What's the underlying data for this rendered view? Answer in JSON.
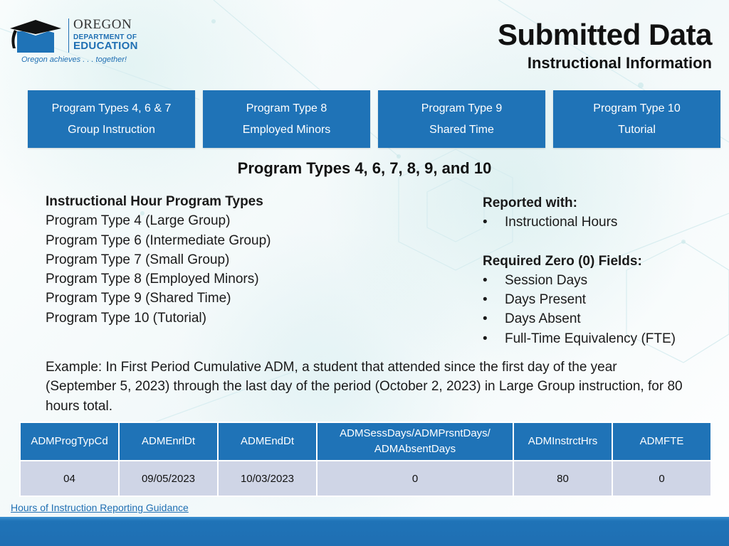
{
  "logo": {
    "oregon": "OREGON",
    "department": "DEPARTMENT OF",
    "education": "EDUCATION",
    "tagline": "Oregon achieves . . . together!"
  },
  "header": {
    "title": "Submitted Data",
    "subtitle": "Instructional Information"
  },
  "tiles": [
    {
      "line1": "Program Types 4, 6 & 7",
      "line2": "Group Instruction"
    },
    {
      "line1": "Program Type 8",
      "line2": "Employed Minors"
    },
    {
      "line1": "Program Type 9",
      "line2": "Shared Time"
    },
    {
      "line1": "Program Type 10",
      "line2": "Tutorial"
    }
  ],
  "section_heading": "Program Types 4, 6, 7, 8, 9, and 10",
  "left": {
    "heading": "Instructional Hour Program Types",
    "items": [
      "Program Type 4 (Large Group)",
      "Program Type 6 (Intermediate Group)",
      "Program Type 7 (Small Group)",
      "Program Type 8 (Employed Minors)",
      "Program Type 9 (Shared Time)",
      "Program Type 10 (Tutorial)"
    ]
  },
  "right": {
    "reported_heading": "Reported with:",
    "reported_items": [
      "Instructional Hours"
    ],
    "zero_heading": "Required Zero (0) Fields:",
    "zero_items": [
      "Session Days",
      "Days Present",
      "Days Absent",
      "Full-Time Equivalency (FTE)"
    ]
  },
  "example": "Example: In First Period Cumulative ADM, a student that attended since the first day of the year (September 5, 2023) through the last day of the period (October 2, 2023) in Large Group instruction, for 80 hours total.",
  "table": {
    "headers": [
      "ADMProgTypCd",
      "ADMEnrlDt",
      "ADMEndDt",
      "ADMSessDays/ADMPrsntDays/",
      "ADMInstrctHrs",
      "ADMFTE"
    ],
    "header4_line2": "ADMAbsentDays",
    "row": [
      "04",
      "09/05/2023",
      "10/03/2023",
      "0",
      "80",
      "0"
    ]
  },
  "link": "Hours of Instruction Reporting Guidance",
  "colors": {
    "brand_blue": "#1f73b7",
    "table_row": "#cfd5e6"
  }
}
